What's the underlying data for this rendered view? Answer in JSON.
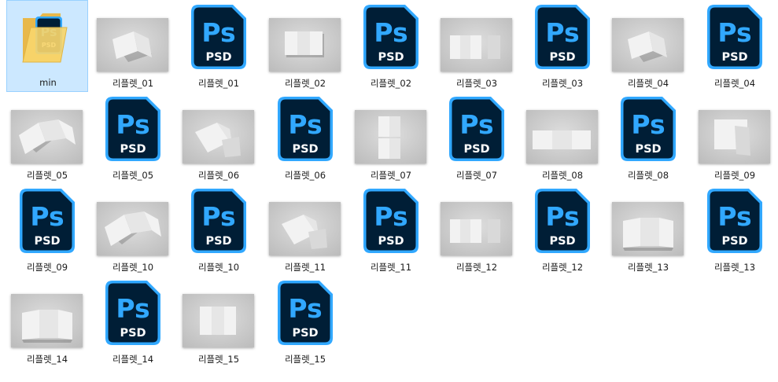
{
  "colors": {
    "selection_bg": "#cce8ff",
    "selection_border": "#99d1ff",
    "psd_body": "#001e36",
    "psd_border": "#31a8ff",
    "psd_text": "#31a8ff",
    "psd_sub_text": "#ffffff",
    "folder_yellow": "#f7d56b"
  },
  "psd_icon": {
    "logo": "Ps",
    "sub": "PSD"
  },
  "items": [
    {
      "kind": "folder",
      "label": "min",
      "icon": "folder-icon",
      "selected": true
    },
    {
      "kind": "photo",
      "label": "리플렛_01",
      "variant": "trifold-tilted"
    },
    {
      "kind": "psd",
      "label": "리플렛_01",
      "icon": "photoshop-file-icon"
    },
    {
      "kind": "photo",
      "label": "리플렛_02",
      "variant": "flat-sheet"
    },
    {
      "kind": "psd",
      "label": "리플렛_02",
      "icon": "photoshop-file-icon"
    },
    {
      "kind": "photo",
      "label": "리플렛_03",
      "variant": "open-with-cover"
    },
    {
      "kind": "psd",
      "label": "리플렛_03",
      "icon": "photoshop-file-icon"
    },
    {
      "kind": "photo",
      "label": "리플렛_04",
      "variant": "trifold-tilted"
    },
    {
      "kind": "psd",
      "label": "리플렛_04",
      "icon": "photoshop-file-icon"
    },
    {
      "kind": "photo",
      "label": "리플렛_05",
      "variant": "open-tilted"
    },
    {
      "kind": "psd",
      "label": "리플렛_05",
      "icon": "photoshop-file-icon"
    },
    {
      "kind": "photo",
      "label": "리플렛_06",
      "variant": "stacked-tilted"
    },
    {
      "kind": "psd",
      "label": "리플렛_06",
      "icon": "photoshop-file-icon"
    },
    {
      "kind": "photo",
      "label": "리플렛_07",
      "variant": "vertical-pair"
    },
    {
      "kind": "psd",
      "label": "리플렛_07",
      "icon": "photoshop-file-icon"
    },
    {
      "kind": "photo",
      "label": "리플렛_08",
      "variant": "wide-open"
    },
    {
      "kind": "psd",
      "label": "리플렛_08",
      "icon": "photoshop-file-icon"
    },
    {
      "kind": "photo",
      "label": "리플렛_09",
      "variant": "overlap-pair"
    },
    {
      "kind": "psd",
      "label": "리플렛_09",
      "icon": "photoshop-file-icon"
    },
    {
      "kind": "photo",
      "label": "리플렛_10",
      "variant": "open-tilted"
    },
    {
      "kind": "psd",
      "label": "리플렛_10",
      "icon": "photoshop-file-icon"
    },
    {
      "kind": "photo",
      "label": "리플렛_11",
      "variant": "stacked-tilted"
    },
    {
      "kind": "psd",
      "label": "리플렛_11",
      "icon": "photoshop-file-icon"
    },
    {
      "kind": "photo",
      "label": "리플렛_12",
      "variant": "open-with-cover"
    },
    {
      "kind": "psd",
      "label": "리플렛_12",
      "icon": "photoshop-file-icon"
    },
    {
      "kind": "photo",
      "label": "리플렛_13",
      "variant": "standing-trifold"
    },
    {
      "kind": "psd",
      "label": "리플렛_13",
      "icon": "photoshop-file-icon"
    },
    {
      "kind": "photo",
      "label": "리플렛_14",
      "variant": "standing-trifold"
    },
    {
      "kind": "psd",
      "label": "리플렛_14",
      "icon": "photoshop-file-icon"
    },
    {
      "kind": "photo",
      "label": "리플렛_15",
      "variant": "flat-trifold"
    },
    {
      "kind": "psd",
      "label": "리플렛_15",
      "icon": "photoshop-file-icon"
    }
  ]
}
